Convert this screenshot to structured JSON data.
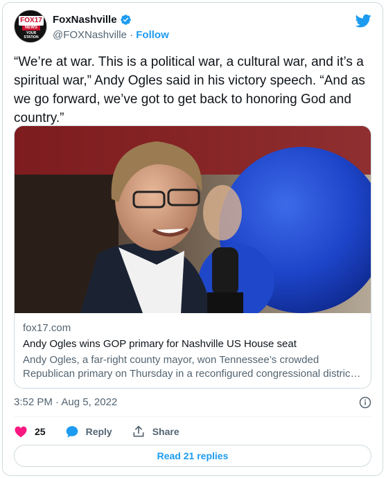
{
  "colors": {
    "accent": "#1d9bf0",
    "like": "#f91880",
    "text": "#0f1419",
    "muted": "#536471"
  },
  "author": {
    "display_name": "FoxNashville",
    "handle": "@FOXNashville",
    "separator": "·",
    "follow_label": "Follow",
    "avatar": {
      "logo_text_1": "FOX",
      "logo_text_2": "17",
      "logo_text_3": "NEWS",
      "logo_text_4": "YOUR STATION"
    }
  },
  "tweet": {
    "text": "“We’re at war. This is a political war, a cultural war, and it’s a spiritual war,” Andy Ogles said in his victory speech. “And as we go forward, we’ve got to get back to honoring God and country.”",
    "timestamp": "3:52 PM · Aug 5, 2022"
  },
  "card": {
    "domain": "fox17.com",
    "title": "Andy Ogles wins GOP primary for Nashville US House seat",
    "description_line1": "Andy Ogles, a far-right county mayor, won Tennessee’s crowded",
    "description_line2": "Republican primary on Thursday in a reconfigured congressional district ..."
  },
  "actions": {
    "like_count": "25",
    "reply_label": "Reply",
    "share_label": "Share"
  },
  "read_replies_label": "Read 21 replies",
  "icons": [
    "verified-icon",
    "twitter-bird-icon",
    "info-icon",
    "heart-icon",
    "reply-bubble-icon",
    "share-icon"
  ]
}
